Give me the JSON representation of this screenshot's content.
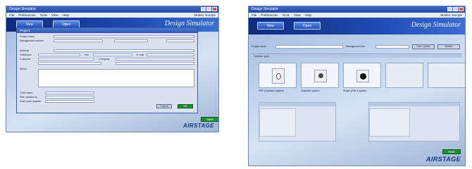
{
  "app": {
    "window_title": "Design Simulator",
    "menu": [
      "File",
      "Preferences",
      "Tools",
      "View",
      "Help"
    ],
    "modes_label": "Modes: Europe",
    "nav_new": "New",
    "nav_open": "Open",
    "logo_text": "Design Simulator",
    "brand": "AIRSTAGE",
    "next_label": "Next"
  },
  "project_dialog": {
    "title": "Project",
    "fields": [
      {
        "label": "Project name"
      },
      {
        "label": "Management number"
      },
      {
        "label": "Address"
      },
      {
        "label": "Telephone"
      },
      {
        "label": "Fax"
      },
      {
        "label": "E-mail"
      },
      {
        "label": "Customer"
      },
      {
        "label": "Company"
      }
    ],
    "memo_label": "Memo",
    "bottom_fields": [
      {
        "label": "Chief name"
      },
      {
        "label": "Plan created by"
      },
      {
        "label": "Date (Last update)"
      }
    ],
    "ok_label": "OK",
    "cancel_label": "Cancel"
  },
  "selection": {
    "project_name_label": "Project name",
    "management_label": "Management No.",
    "user_option_label": "User option",
    "delete_label": "Delete",
    "system_type_label": "System type",
    "tiles": [
      {
        "caption": "VRF (Outdoor) system",
        "icon": "outdoor-unit-icon"
      },
      {
        "caption": "Cassette system",
        "icon": "indoor-unit-icon"
      },
      {
        "caption": "Single (RAC) system",
        "icon": "single-split-icon"
      },
      {
        "caption": ""
      },
      {
        "caption": ""
      }
    ]
  },
  "colors": {
    "header_blue": "#1f4bb3",
    "next_green": "#1c8e33",
    "brand_navy": "#17357f"
  }
}
